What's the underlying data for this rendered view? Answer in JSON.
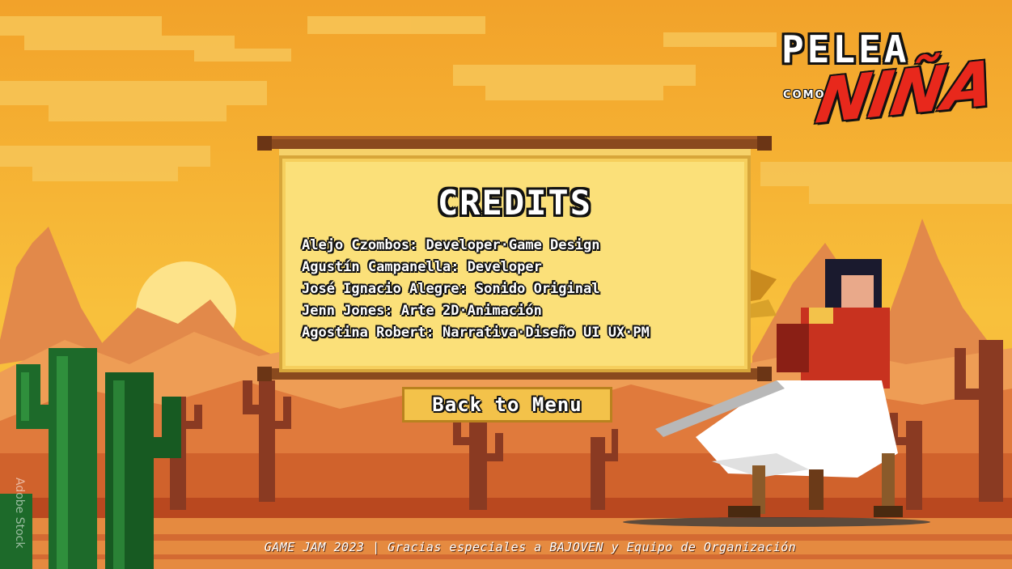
{
  "logo": {
    "line1": "PELEA",
    "line2": "COMO",
    "line3": "NIÑA"
  },
  "credits": {
    "title": "CREDITS",
    "entries": [
      "Alejo Czombos: Developer·Game Design",
      "Agustín Campanella: Developer",
      "José Ignacio Alegre: Sonido Original",
      "Jenn Jones: Arte 2D·Animación",
      "Agostina Robert: Narrativa·Diseño UI UX·PM"
    ]
  },
  "back_button": {
    "label": "Back to Menu"
  },
  "footer": {
    "text": "GAME JAM 2023 | Gracias especiales a BAJOVEN y Equipo de Organización"
  },
  "watermark": {
    "text": "Adobe Stock"
  },
  "colors": {
    "sky_top": "#f2a42c",
    "sky_bottom": "#f9c43e",
    "panel_bg": "#fbe079",
    "button_bg": "#f3c24a",
    "logo_red": "#e8281c"
  }
}
